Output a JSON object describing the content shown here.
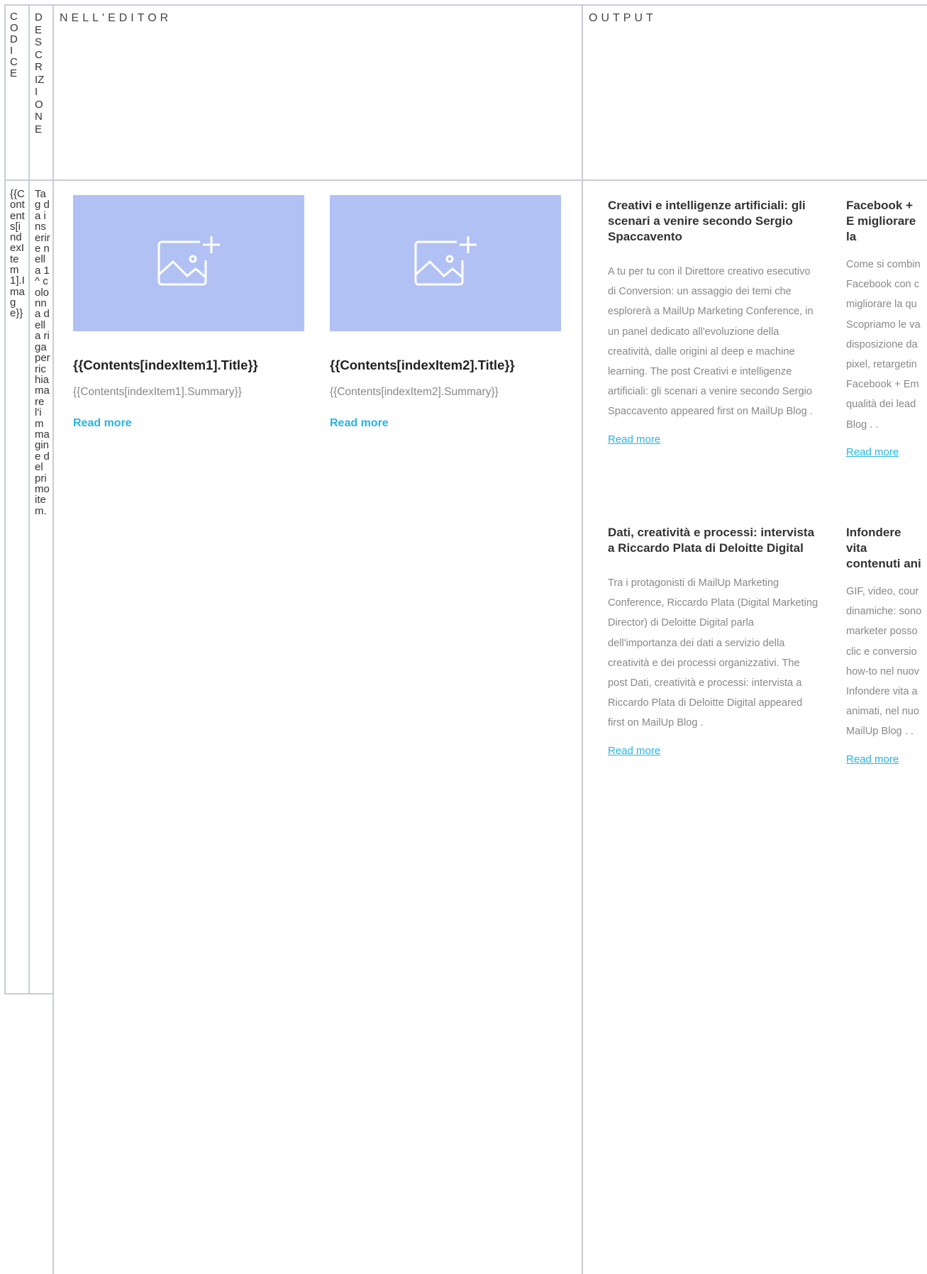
{
  "header": {
    "code_label": "CODICE",
    "description_label": "DESCRIZIONE",
    "editor_label": "NELL'EDITOR",
    "output_label": "OUTPUT"
  },
  "row": {
    "code": "{{Contents[indexItem1].Image}}",
    "description": "Tag da inserire nella 1^ colonna della riga per richiamare l'immagine del primo item."
  },
  "editor": {
    "items": [
      {
        "title": "{{Contents[indexItem1].Title}}",
        "summary": "{{Contents[indexItem1].Summary}}",
        "read_more": "Read more"
      },
      {
        "title": "{{Contents[indexItem2].Title}}",
        "summary": "{{Contents[indexItem2].Summary}}",
        "read_more": "Read more"
      }
    ]
  },
  "output": {
    "articles": [
      {
        "title": "Creativi e intelligenze artificiali: gli scenari a venire secondo Sergio Spaccavento",
        "body": "A tu per tu con il Direttore creativo esecutivo di Conversion: un assaggio dei temi che esplorerà a MailUp Marketing Conference, in un panel dedicato all'evoluzione della creatività, dalle origini al deep e machine learning. The post Creativi e intelligenze artificiali: gli scenari a venire secondo Sergio Spaccavento appeared first on MailUp Blog .",
        "read_more": "Read more"
      },
      {
        "title": "Facebook + E migliorare la",
        "body": "Come si combin Facebook con c migliorare la qu Scopriamo le va disposizione da pixel, retargetin Facebook + Em qualità dei lead Blog . .",
        "read_more": "Read more"
      },
      {
        "title": "Dati, creatività e processi: intervista a Riccardo Plata di Deloitte Digital",
        "body": "Tra i protagonisti di MailUp Marketing Conference, Riccardo Plata (Digital Marketing Director) di Deloitte Digital parla dell'importanza dei dati a servizio della creatività e dei processi organizzativi. The post Dati, creatività e processi: intervista a Riccardo Plata di Deloitte Digital appeared first on MailUp Blog .",
        "read_more": "Read more"
      },
      {
        "title": "Infondere vita contenuti ani",
        "body": "GIF, video, cour dinamiche: sono marketer posso clic e conversio how-to nel nuov Infondere vita a animati, nel nuo MailUp Blog . .",
        "read_more": "Read more"
      }
    ]
  }
}
